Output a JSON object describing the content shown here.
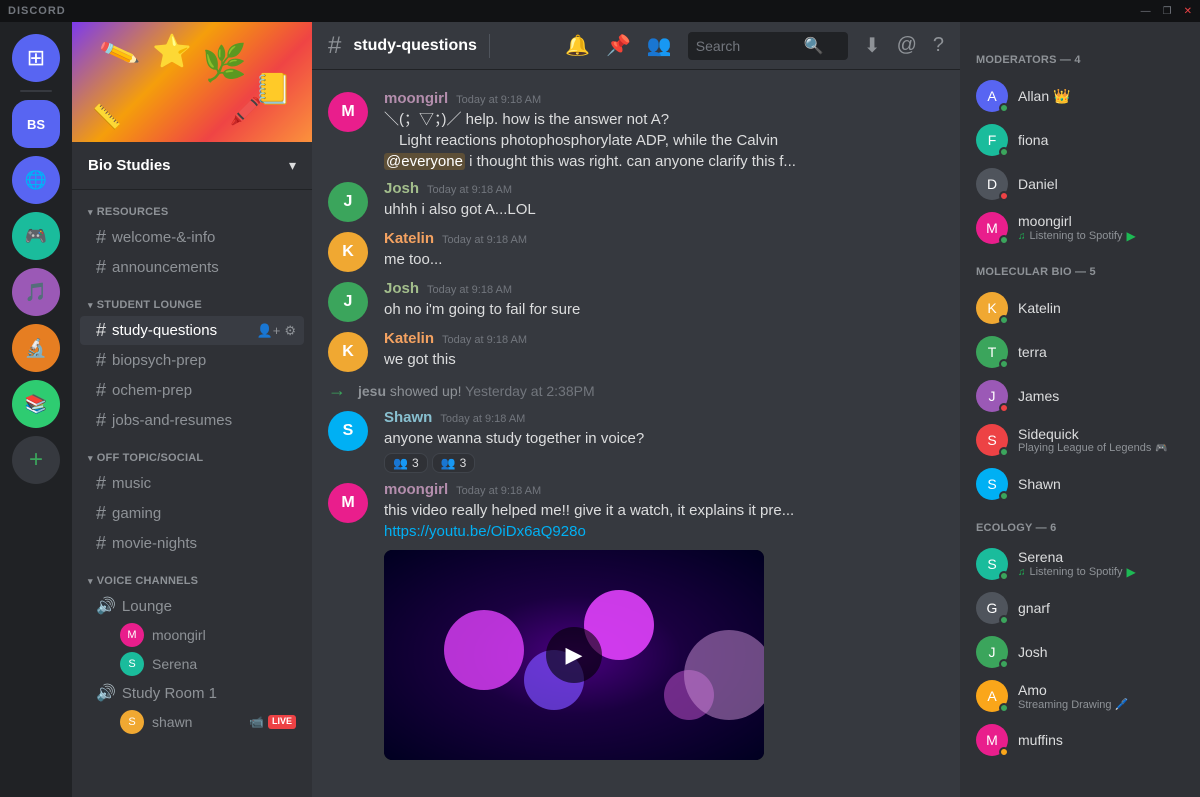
{
  "titlebar": {
    "title": "DISCORD",
    "minimize": "—",
    "maximize": "❐",
    "close": "✕"
  },
  "server": {
    "name": "Bio Studies",
    "banner_emoji": "🌱"
  },
  "sidebar": {
    "categories": [
      {
        "name": "RESOURCES",
        "channels": [
          {
            "name": "welcome-&-info",
            "type": "text"
          },
          {
            "name": "announcements",
            "type": "text"
          }
        ]
      },
      {
        "name": "STUDENT LOUNGE",
        "channels": [
          {
            "name": "study-questions",
            "type": "text",
            "active": true
          },
          {
            "name": "biopsych-prep",
            "type": "text"
          },
          {
            "name": "ochem-prep",
            "type": "text"
          },
          {
            "name": "jobs-and-resumes",
            "type": "text"
          }
        ]
      },
      {
        "name": "OFF TOPIC/SOCIAL",
        "channels": [
          {
            "name": "music",
            "type": "text"
          },
          {
            "name": "gaming",
            "type": "text"
          },
          {
            "name": "movie-nights",
            "type": "text"
          }
        ]
      }
    ],
    "voice": {
      "category": "VOICE CHANNELS",
      "channels": [
        {
          "name": "Lounge",
          "users": [
            {
              "name": "moongirl",
              "color": "av-pink"
            },
            {
              "name": "Serena",
              "color": "av-teal"
            }
          ]
        },
        {
          "name": "Study Room 1",
          "users": [
            {
              "name": "shawn",
              "color": "av-orange",
              "live": true
            }
          ]
        }
      ]
    }
  },
  "channel": {
    "name": "study-questions"
  },
  "messages": [
    {
      "id": "msg1",
      "author": "moongirl",
      "author_class": "moongirl",
      "timestamp": "Today at 9:18 AM",
      "avatar_color": "av-pink",
      "lines": [
        "＼(；▽；)／ help. how is the answer not A?",
        "Light reactions photophosphorylate ADP, while the Calvin",
        "@everyone i thought this was right. can anyone clarify this f..."
      ],
      "has_mention": true
    },
    {
      "id": "msg2",
      "author": "Josh",
      "author_class": "josh",
      "timestamp": "Today at 9:18 AM",
      "avatar_color": "av-green",
      "lines": [
        "uhhh i also got A...LOL"
      ]
    },
    {
      "id": "msg3",
      "author": "Katelin",
      "author_class": "katelin",
      "timestamp": "Today at 9:18 AM",
      "avatar_color": "av-orange",
      "lines": [
        "me too..."
      ]
    },
    {
      "id": "msg4",
      "author": "Josh",
      "author_class": "josh",
      "timestamp": "Today at 9:18 AM",
      "avatar_color": "av-green",
      "lines": [
        "oh no i'm going to fail for sure"
      ]
    },
    {
      "id": "msg5",
      "author": "Katelin",
      "author_class": "katelin",
      "timestamp": "Today at 9:18 AM",
      "avatar_color": "av-orange",
      "lines": [
        "we got this"
      ]
    },
    {
      "id": "msg_system",
      "type": "system",
      "text": "jesu showed up! Yesterday at 2:38PM"
    },
    {
      "id": "msg6",
      "author": "Shawn",
      "author_class": "shawn",
      "timestamp": "Today at 9:18 AM",
      "avatar_color": "av-cyan",
      "lines": [
        "anyone wanna study together in voice?"
      ],
      "reactions": [
        {
          "emoji": "👥",
          "count": "3"
        },
        {
          "emoji": "👥",
          "count": "3"
        }
      ]
    },
    {
      "id": "msg7",
      "author": "moongirl",
      "author_class": "moongirl",
      "timestamp": "Today at 9:18 AM",
      "avatar_color": "av-pink",
      "lines": [
        "this video really helped me!! give it a watch, it explains it pre..."
      ],
      "link": "https://youtu.be/OiDx6aQ928o",
      "has_video": true
    }
  ],
  "members": {
    "sections": [
      {
        "title": "MODERATORS — 4",
        "members": [
          {
            "name": "Allan",
            "color": "av-blue",
            "status": "online",
            "crown": true
          },
          {
            "name": "fiona",
            "color": "av-teal",
            "status": "online"
          },
          {
            "name": "Daniel",
            "color": "av-dark",
            "status": "dnd"
          },
          {
            "name": "moongirl",
            "color": "av-pink",
            "status": "online",
            "activity": "Listening to Spotify",
            "spotify": true
          }
        ]
      },
      {
        "title": "MOLECULAR BIO — 5",
        "members": [
          {
            "name": "Katelin",
            "color": "av-orange",
            "status": "online"
          },
          {
            "name": "terra",
            "color": "av-green",
            "status": "online"
          },
          {
            "name": "James",
            "color": "av-purple",
            "status": "dnd"
          },
          {
            "name": "Sidequick",
            "color": "av-red",
            "status": "online",
            "activity": "Playing League of Legends",
            "game": true
          },
          {
            "name": "Shawn",
            "color": "av-cyan",
            "status": "online"
          }
        ]
      },
      {
        "title": "ECOLOGY — 6",
        "members": [
          {
            "name": "Serena",
            "color": "av-teal",
            "status": "online",
            "activity": "Listening to Spotify",
            "spotify": true
          },
          {
            "name": "gnarf",
            "color": "av-dark",
            "status": "online"
          },
          {
            "name": "Josh",
            "color": "av-green",
            "status": "online"
          },
          {
            "name": "Amo",
            "color": "av-yellow",
            "status": "online",
            "activity": "Streaming Drawing 🖊️"
          },
          {
            "name": "muffins",
            "color": "av-pink",
            "status": "idle"
          }
        ]
      }
    ]
  },
  "header_icons": {
    "bell": "🔔",
    "pin": "📌",
    "members": "👥",
    "search_placeholder": "Search",
    "download": "⬇",
    "mention": "@",
    "help": "?"
  }
}
